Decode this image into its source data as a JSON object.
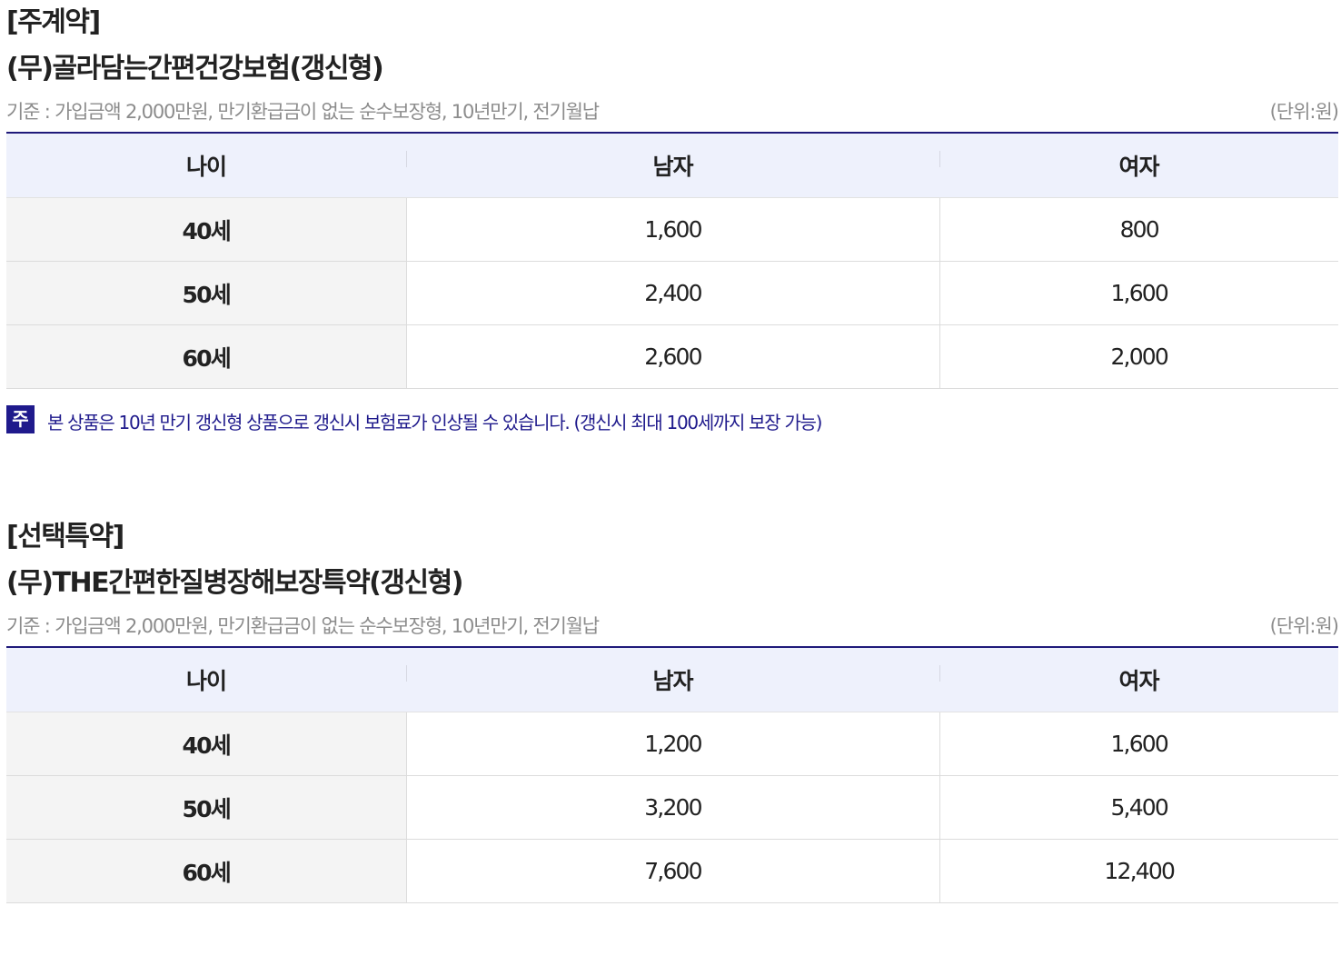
{
  "main_contract": {
    "tag": "[주계약]",
    "title": "(무)골라담는간편건강보험(갱신형)",
    "criteria": "기준 : 가입금액 2,000만원, 만기환급금이 없는 순수보장형, 10년만기, 전기월납",
    "unit": "(단위:원)",
    "headers": {
      "age": "나이",
      "male": "남자",
      "female": "여자"
    },
    "rows": [
      {
        "age": "40세",
        "male": "1,600",
        "female": "800"
      },
      {
        "age": "50세",
        "male": "2,400",
        "female": "1,600"
      },
      {
        "age": "60세",
        "male": "2,600",
        "female": "2,000"
      }
    ],
    "note": {
      "badge": "주",
      "text": "본 상품은 10년 만기 갱신형 상품으로 갱신시 보험료가 인상될 수 있습니다. (갱신시 최대 100세까지 보장 가능)"
    }
  },
  "rider": {
    "tag": "[선택특약]",
    "title": "(무)THE간편한질병장해보장특약(갱신형)",
    "criteria": "기준 : 가입금액 2,000만원, 만기환급금이 없는 순수보장형, 10년만기, 전기월납",
    "unit": "(단위:원)",
    "headers": {
      "age": "나이",
      "male": "남자",
      "female": "여자"
    },
    "rows": [
      {
        "age": "40세",
        "male": "1,200",
        "female": "1,600"
      },
      {
        "age": "50세",
        "male": "3,200",
        "female": "5,400"
      },
      {
        "age": "60세",
        "male": "7,600",
        "female": "12,400"
      }
    ]
  },
  "colors": {
    "accent": "#1f1a8c",
    "header_bg": "#eef1fc",
    "age_col_bg": "#f4f4f4",
    "muted_text": "#8c8c8c"
  }
}
